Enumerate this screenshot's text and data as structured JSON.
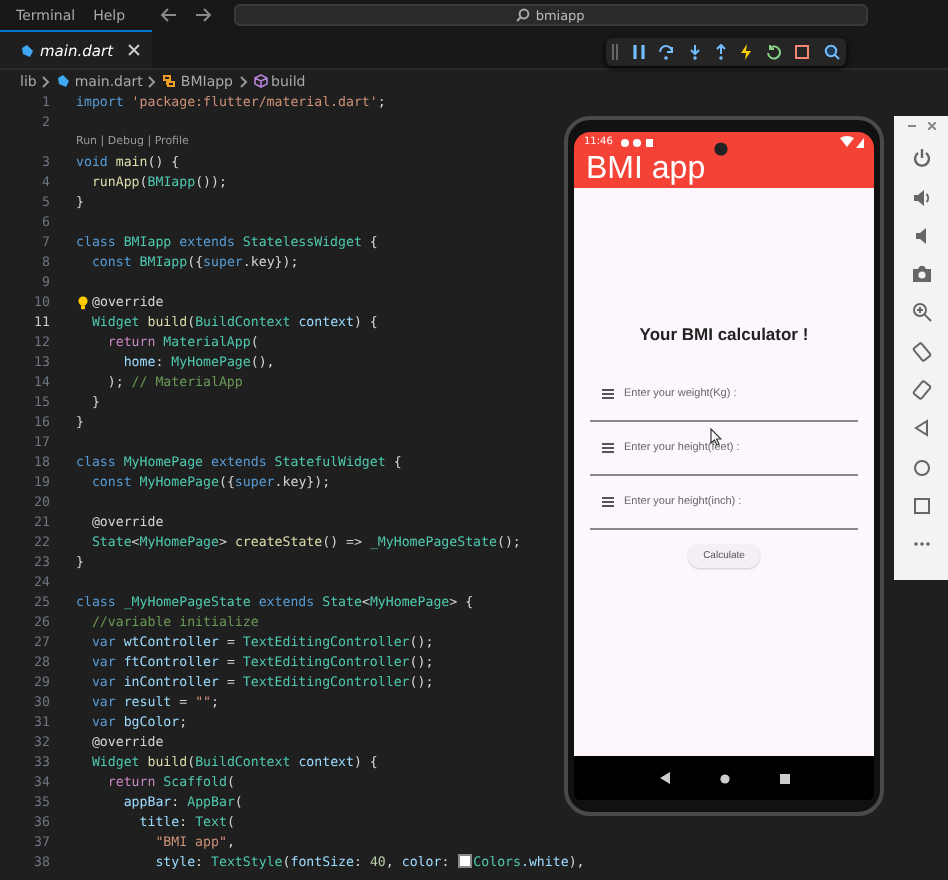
{
  "menu": [
    "Terminal",
    "Help"
  ],
  "search": {
    "value": "bmiapp"
  },
  "tabs": [
    {
      "label": "main.dart",
      "selected": true
    }
  ],
  "breadcrumb": [
    {
      "label": "lib",
      "kind": "folder"
    },
    {
      "label": "main.dart",
      "kind": "file"
    },
    {
      "label": "BMIapp",
      "kind": "class"
    },
    {
      "label": "build",
      "kind": "method"
    }
  ],
  "editor": {
    "lines": [
      {
        "kind": "code",
        "number": "1",
        "tokens": [
          {
            "text": "import ",
            "kind": "keyword"
          },
          {
            "text": "'package:flutter/material.dart'",
            "kind": "string"
          },
          {
            "text": ";",
            "kind": "plain"
          }
        ]
      },
      {
        "kind": "code",
        "number": "2"
      },
      {
        "kind": "lens",
        "text": "Run | Debug | Profile"
      },
      {
        "kind": "code",
        "number": "3",
        "tokens": [
          {
            "text": "void ",
            "kind": "keyword"
          },
          {
            "text": "main",
            "kind": "function"
          },
          {
            "text": "() {",
            "kind": "plain"
          }
        ]
      },
      {
        "kind": "code",
        "number": "4",
        "tokens": [
          {
            "text": "  runApp",
            "kind": "function"
          },
          {
            "text": "(",
            "kind": "plain"
          },
          {
            "text": "BMIapp",
            "kind": "type"
          },
          {
            "text": "());",
            "kind": "plain"
          }
        ]
      },
      {
        "kind": "code",
        "number": "5",
        "tokens": [
          {
            "text": "}",
            "kind": "plain"
          }
        ]
      },
      {
        "kind": "code",
        "number": "6"
      },
      {
        "kind": "code",
        "number": "7",
        "tokens": [
          {
            "text": "class ",
            "kind": "keyword"
          },
          {
            "text": "BMIapp ",
            "kind": "type"
          },
          {
            "text": "extends ",
            "kind": "keyword"
          },
          {
            "text": "StatelessWidget ",
            "kind": "type"
          },
          {
            "text": "{",
            "kind": "plain"
          }
        ]
      },
      {
        "kind": "code",
        "number": "8",
        "tokens": [
          {
            "text": "  const ",
            "kind": "keyword"
          },
          {
            "text": "BMIapp",
            "kind": "type"
          },
          {
            "text": "({",
            "kind": "plain"
          },
          {
            "text": "super",
            "kind": "keyword"
          },
          {
            "text": ".key});",
            "kind": "plain"
          }
        ]
      },
      {
        "kind": "code",
        "number": "9"
      },
      {
        "kind": "code",
        "number": "10",
        "lightbulb": true,
        "tokens": [
          {
            "text": "@override",
            "kind": "plain"
          }
        ]
      },
      {
        "kind": "code",
        "number": "11",
        "current": true,
        "tokens": [
          {
            "text": "  Widget ",
            "kind": "type"
          },
          {
            "text": "build",
            "kind": "function"
          },
          {
            "text": "(",
            "kind": "plain"
          },
          {
            "text": "BuildContext ",
            "kind": "type"
          },
          {
            "text": "context",
            "kind": "variable"
          },
          {
            "text": ") {",
            "kind": "plain"
          }
        ]
      },
      {
        "kind": "code",
        "number": "12",
        "tokens": [
          {
            "text": "    return ",
            "kind": "control"
          },
          {
            "text": "MaterialApp",
            "kind": "type"
          },
          {
            "text": "(",
            "kind": "plain"
          }
        ]
      },
      {
        "kind": "code",
        "number": "13",
        "tokens": [
          {
            "text": "      home",
            "kind": "variable"
          },
          {
            "text": ": ",
            "kind": "plain"
          },
          {
            "text": "MyHomePage",
            "kind": "type"
          },
          {
            "text": "(),",
            "kind": "plain"
          }
        ]
      },
      {
        "kind": "code",
        "number": "14",
        "tokens": [
          {
            "text": "    ); ",
            "kind": "plain"
          },
          {
            "text": "// MaterialApp",
            "kind": "comment"
          }
        ]
      },
      {
        "kind": "code",
        "number": "15",
        "tokens": [
          {
            "text": "  }",
            "kind": "plain"
          }
        ]
      },
      {
        "kind": "code",
        "number": "16",
        "tokens": [
          {
            "text": "}",
            "kind": "plain"
          }
        ]
      },
      {
        "kind": "code",
        "number": "17"
      },
      {
        "kind": "code",
        "number": "18",
        "tokens": [
          {
            "text": "class ",
            "kind": "keyword"
          },
          {
            "text": "MyHomePage ",
            "kind": "type"
          },
          {
            "text": "extends ",
            "kind": "keyword"
          },
          {
            "text": "StatefulWidget ",
            "kind": "type"
          },
          {
            "text": "{",
            "kind": "plain"
          }
        ]
      },
      {
        "kind": "code",
        "number": "19",
        "tokens": [
          {
            "text": "  const ",
            "kind": "keyword"
          },
          {
            "text": "MyHomePage",
            "kind": "type"
          },
          {
            "text": "({",
            "kind": "plain"
          },
          {
            "text": "super",
            "kind": "keyword"
          },
          {
            "text": ".key});",
            "kind": "plain"
          }
        ]
      },
      {
        "kind": "code",
        "number": "20"
      },
      {
        "kind": "code",
        "number": "21",
        "tokens": [
          {
            "text": "  @override",
            "kind": "plain"
          }
        ]
      },
      {
        "kind": "code",
        "number": "22",
        "tokens": [
          {
            "text": "  State",
            "kind": "type"
          },
          {
            "text": "<",
            "kind": "plain"
          },
          {
            "text": "MyHomePage",
            "kind": "type"
          },
          {
            "text": "> ",
            "kind": "plain"
          },
          {
            "text": "createState",
            "kind": "function"
          },
          {
            "text": "() => ",
            "kind": "plain"
          },
          {
            "text": "_MyHomePageState",
            "kind": "type"
          },
          {
            "text": "();",
            "kind": "plain"
          }
        ]
      },
      {
        "kind": "code",
        "number": "23",
        "tokens": [
          {
            "text": "}",
            "kind": "plain"
          }
        ]
      },
      {
        "kind": "code",
        "number": "24"
      },
      {
        "kind": "code",
        "number": "25",
        "tokens": [
          {
            "text": "class ",
            "kind": "keyword"
          },
          {
            "text": "_MyHomePageState ",
            "kind": "type"
          },
          {
            "text": "extends ",
            "kind": "keyword"
          },
          {
            "text": "State",
            "kind": "type"
          },
          {
            "text": "<",
            "kind": "plain"
          },
          {
            "text": "MyHomePage",
            "kind": "type"
          },
          {
            "text": "> {",
            "kind": "plain"
          }
        ]
      },
      {
        "kind": "code",
        "number": "26",
        "tokens": [
          {
            "text": "  //variable initialize",
            "kind": "comment"
          }
        ]
      },
      {
        "kind": "code",
        "number": "27",
        "tokens": [
          {
            "text": "  var ",
            "kind": "keyword"
          },
          {
            "text": "wtController ",
            "kind": "variable"
          },
          {
            "text": "= ",
            "kind": "plain"
          },
          {
            "text": "TextEditingController",
            "kind": "type"
          },
          {
            "text": "();",
            "kind": "plain"
          }
        ]
      },
      {
        "kind": "code",
        "number": "28",
        "tokens": [
          {
            "text": "  var ",
            "kind": "keyword"
          },
          {
            "text": "ftController ",
            "kind": "variable"
          },
          {
            "text": "= ",
            "kind": "plain"
          },
          {
            "text": "TextEditingController",
            "kind": "type"
          },
          {
            "text": "();",
            "kind": "plain"
          }
        ]
      },
      {
        "kind": "code",
        "number": "29",
        "tokens": [
          {
            "text": "  var ",
            "kind": "keyword"
          },
          {
            "text": "inController ",
            "kind": "variable"
          },
          {
            "text": "= ",
            "kind": "plain"
          },
          {
            "text": "TextEditingController",
            "kind": "type"
          },
          {
            "text": "();",
            "kind": "plain"
          }
        ]
      },
      {
        "kind": "code",
        "number": "30",
        "tokens": [
          {
            "text": "  var ",
            "kind": "keyword"
          },
          {
            "text": "result ",
            "kind": "variable"
          },
          {
            "text": "= ",
            "kind": "plain"
          },
          {
            "text": "\"\"",
            "kind": "string"
          },
          {
            "text": ";",
            "kind": "plain"
          }
        ]
      },
      {
        "kind": "code",
        "number": "31",
        "tokens": [
          {
            "text": "  var ",
            "kind": "keyword"
          },
          {
            "text": "bgColor",
            "kind": "variable"
          },
          {
            "text": ";",
            "kind": "plain"
          }
        ]
      },
      {
        "kind": "code",
        "number": "32",
        "tokens": [
          {
            "text": "  @override",
            "kind": "plain"
          }
        ]
      },
      {
        "kind": "code",
        "number": "33",
        "tokens": [
          {
            "text": "  Widget ",
            "kind": "type"
          },
          {
            "text": "build",
            "kind": "function"
          },
          {
            "text": "(",
            "kind": "plain"
          },
          {
            "text": "BuildContext ",
            "kind": "type"
          },
          {
            "text": "context",
            "kind": "variable"
          },
          {
            "text": ") {",
            "kind": "plain"
          }
        ]
      },
      {
        "kind": "code",
        "number": "34",
        "tokens": [
          {
            "text": "    return ",
            "kind": "control"
          },
          {
            "text": "Scaffold",
            "kind": "type"
          },
          {
            "text": "(",
            "kind": "plain"
          }
        ]
      },
      {
        "kind": "code",
        "number": "35",
        "tokens": [
          {
            "text": "      appBar",
            "kind": "variable"
          },
          {
            "text": ": ",
            "kind": "plain"
          },
          {
            "text": "AppBar",
            "kind": "type"
          },
          {
            "text": "(",
            "kind": "plain"
          }
        ]
      },
      {
        "kind": "code",
        "number": "36",
        "tokens": [
          {
            "text": "        title",
            "kind": "variable"
          },
          {
            "text": ": ",
            "kind": "plain"
          },
          {
            "text": "Text",
            "kind": "type"
          },
          {
            "text": "(",
            "kind": "plain"
          }
        ]
      },
      {
        "kind": "code",
        "number": "37",
        "tokens": [
          {
            "text": "          \"BMI app\"",
            "kind": "string"
          },
          {
            "text": ",",
            "kind": "plain"
          }
        ]
      },
      {
        "kind": "code",
        "number": "38",
        "tokens": [
          {
            "text": "          style",
            "kind": "variable"
          },
          {
            "text": ": ",
            "kind": "plain"
          },
          {
            "text": "TextStyle",
            "kind": "type"
          },
          {
            "text": "(",
            "kind": "plain"
          },
          {
            "text": "fontSize",
            "kind": "variable"
          },
          {
            "text": ": ",
            "kind": "plain"
          },
          {
            "text": "40",
            "kind": "number"
          },
          {
            "text": ", ",
            "kind": "plain"
          },
          {
            "text": "color",
            "kind": "variable"
          },
          {
            "text": ": ",
            "kind": "plain"
          },
          {
            "kind": "swatch",
            "color": "#ffffff"
          },
          {
            "text": "Colors",
            "kind": "type"
          },
          {
            "text": ".white",
            "kind": "variable"
          },
          {
            "text": "),",
            "kind": "plain"
          }
        ]
      }
    ]
  },
  "emulator": {
    "status_time": "11:46",
    "app_title": "BMI app",
    "heading": "Your BMI calculator !",
    "fields": [
      {
        "placeholder": "Enter your weight(Kg) :"
      },
      {
        "placeholder": "Enter your height(feet) :"
      },
      {
        "placeholder": "Enter your height(inch) :"
      }
    ],
    "button": "Calculate"
  }
}
